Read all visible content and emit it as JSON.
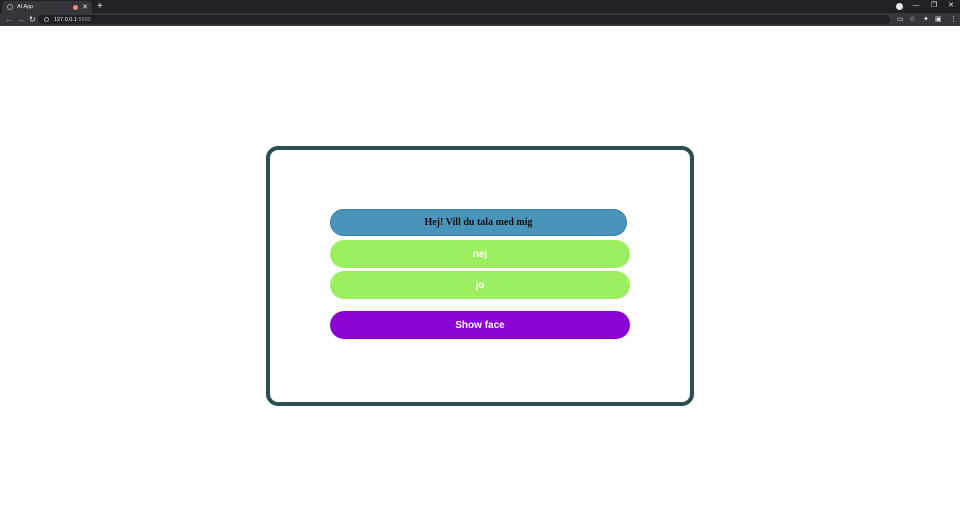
{
  "browser": {
    "tab_title": "AI App",
    "new_tab_symbol": "+",
    "url_host": "127.0.0.1",
    "url_port": ":5500",
    "window_controls": {
      "minimize": "—",
      "restore": "❐",
      "close": "✕"
    }
  },
  "page": {
    "greeting": "Hej! Vill du tala med mig",
    "answers": [
      {
        "label": "nej"
      },
      {
        "label": "jo"
      }
    ],
    "show_face_label": "Show face"
  },
  "colors": {
    "card_border": "#2f4f4f",
    "greeting_bg": "#4a93bb",
    "answer_bg": "#9cf060",
    "show_face_bg": "#8a05d4"
  },
  "icons": [
    "tab-favicon-icon",
    "record-icon",
    "close-icon",
    "back-icon",
    "forward-icon",
    "reload-icon",
    "info-icon",
    "cast-icon",
    "bookmark-star-icon",
    "extensions-icon",
    "profile-icon",
    "menu-icon"
  ]
}
